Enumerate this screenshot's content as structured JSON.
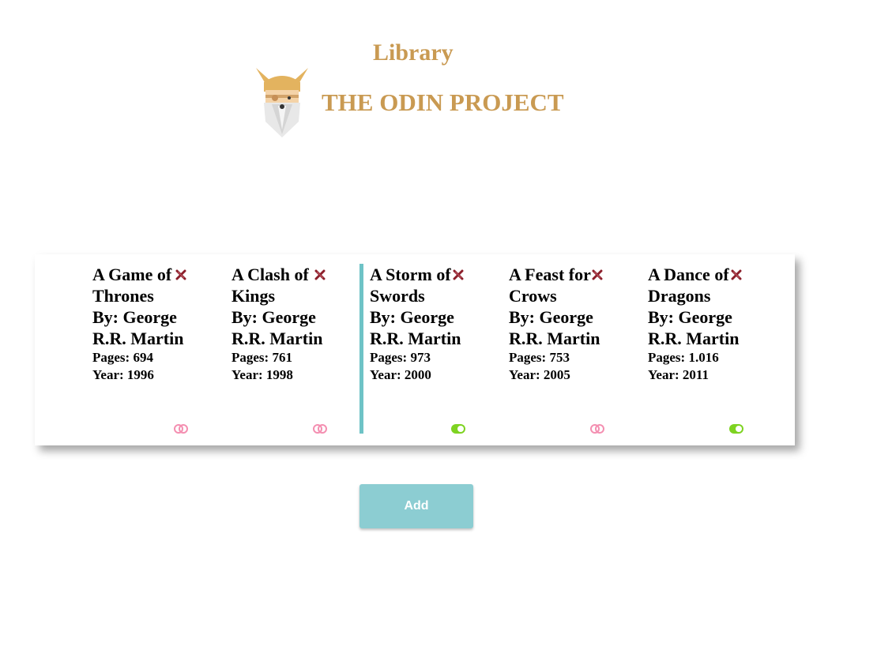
{
  "header": {
    "title": "Library",
    "project_name": "THE ODIN PROJECT"
  },
  "colors": {
    "gold": "#c99a52",
    "teal": "#6ec3c6",
    "read_on": "#7ed321",
    "read_off": "#f48fb1",
    "delete": "#8b1e2a"
  },
  "books": [
    {
      "title": "A Game of Thrones",
      "author": "By: George R.R. Martin",
      "pages": "Pages: 694",
      "year": "Year: 1996",
      "read": false,
      "selected": false
    },
    {
      "title": "A Clash of Kings",
      "author": "By: George R.R. Martin",
      "pages": "Pages: 761",
      "year": "Year: 1998",
      "read": false,
      "selected": false
    },
    {
      "title": "A Storm of Swords",
      "author": "By: George R.R. Martin",
      "pages": "Pages: 973",
      "year": "Year: 2000",
      "read": true,
      "selected": true
    },
    {
      "title": "A Feast for Crows",
      "author": "By: George R.R. Martin",
      "pages": "Pages: 753",
      "year": "Year: 2005",
      "read": false,
      "selected": false
    },
    {
      "title": "A Dance of Dragons",
      "author": "By: George R.R. Martin",
      "pages": "Pages: 1.016",
      "year": "Year: 2011",
      "read": true,
      "selected": false
    }
  ],
  "actions": {
    "add_label": "Add"
  },
  "icons": {
    "logo": "odin-viking-logo-icon",
    "delete": "close-x-icon",
    "toggle": "read-toggle-icon"
  }
}
